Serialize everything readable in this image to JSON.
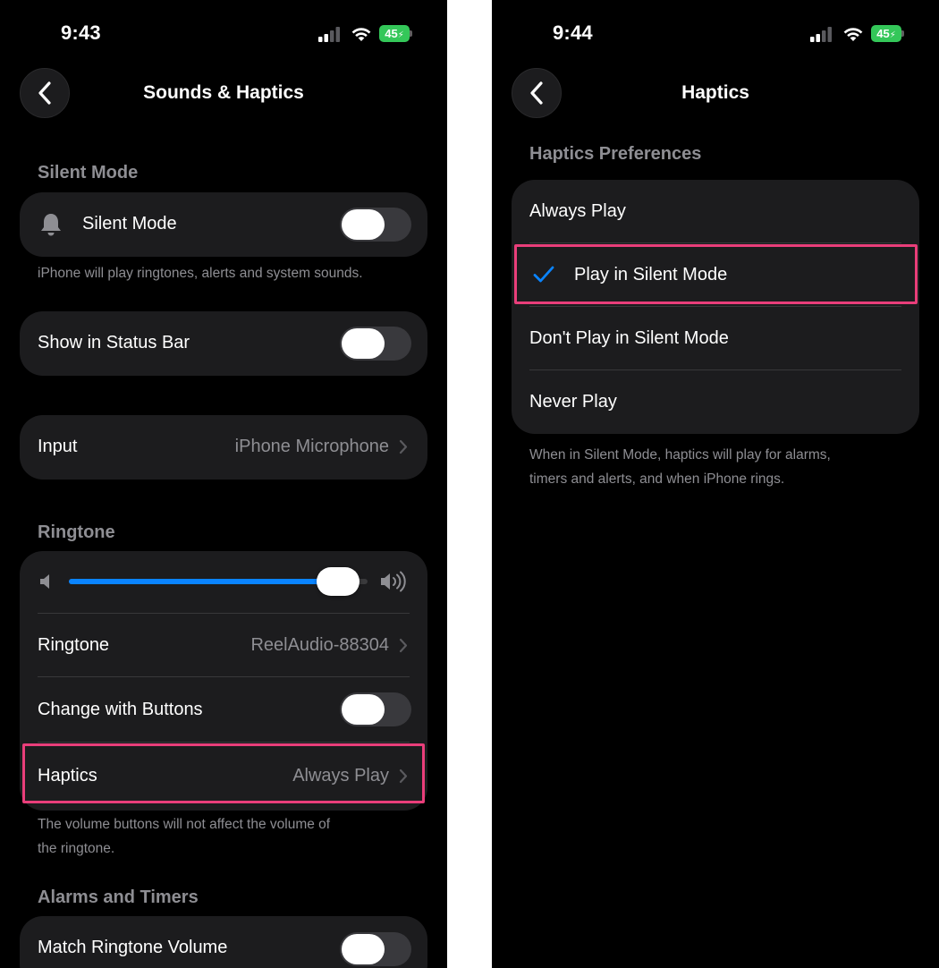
{
  "left": {
    "status": {
      "time": "9:43",
      "battery": "45"
    },
    "nav": {
      "title": "Sounds & Haptics"
    },
    "silent_mode": {
      "header": "Silent Mode",
      "row_label": "Silent Mode",
      "toggle_on": false,
      "footnote": "iPhone will play ringtones, alerts and system sounds."
    },
    "status_bar_row": {
      "label": "Show in Status Bar",
      "toggle_on": false
    },
    "input_row": {
      "label": "Input",
      "value": "iPhone Microphone"
    },
    "ringtone_section": {
      "header": "Ringtone",
      "volume_level": 0.9,
      "ringtone": {
        "label": "Ringtone",
        "value": "ReelAudio-88304"
      },
      "change_with_buttons": {
        "label": "Change with Buttons",
        "toggle_on": false
      },
      "haptics": {
        "label": "Haptics",
        "value": "Always Play"
      },
      "footnote_line1": "The volume buttons will not affect the volume of",
      "footnote_line2": "the ringtone."
    },
    "alarms": {
      "header": "Alarms and Timers",
      "match_volume": {
        "label": "Match Ringtone Volume",
        "toggle_on": false
      }
    }
  },
  "right": {
    "status": {
      "time": "9:44",
      "battery": "45"
    },
    "nav": {
      "title": "Haptics"
    },
    "preferences": {
      "header": "Haptics Preferences",
      "options": [
        "Always Play",
        "Play in Silent Mode",
        "Don't Play in Silent Mode",
        "Never Play"
      ],
      "selected": "Play in Silent Mode",
      "footnote_line1": "When in Silent Mode, haptics will play for alarms,",
      "footnote_line2": "timers and alerts, and when iPhone rings."
    }
  },
  "colors": {
    "accent": "#0a84ff",
    "highlight": "#e93e7a",
    "battery": "#34c759",
    "toggle_off": "#39393d"
  }
}
